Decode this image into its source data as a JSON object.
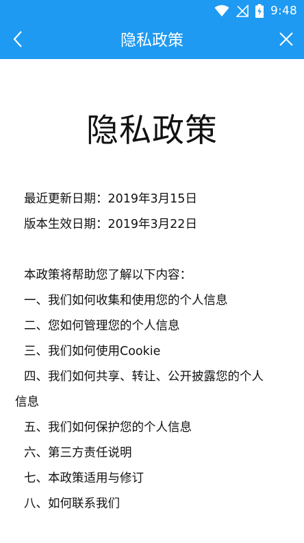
{
  "status_bar": {
    "time": "9:48",
    "icons": [
      "wifi-icon",
      "no-signal-icon",
      "battery-charging-icon"
    ]
  },
  "app_bar": {
    "title": "隐私政策",
    "back_icon": "chevron-left-icon",
    "close_icon": "close-icon"
  },
  "document": {
    "title": "隐私政策",
    "updated": "最近更新日期：2019年3月15日",
    "effective": "版本生效日期：2019年3月22日",
    "intro": "本政策将帮助您了解以下内容：",
    "items": [
      "一、我们如何收集和使用您的个人信息",
      "二、您如何管理您的个人信息",
      "三、我们如何使用Cookie",
      "四、我们如何共享、转让、公开披露您的个人",
      "信息",
      "五、我们如何保护您的个人信息",
      "六、第三方责任说明",
      "七、本政策适用与修订",
      "八、如何联系我们"
    ]
  },
  "colors": {
    "header": "#1e9af2",
    "header_text": "#ffffff",
    "body_text": "#111111",
    "background": "#ffffff"
  }
}
